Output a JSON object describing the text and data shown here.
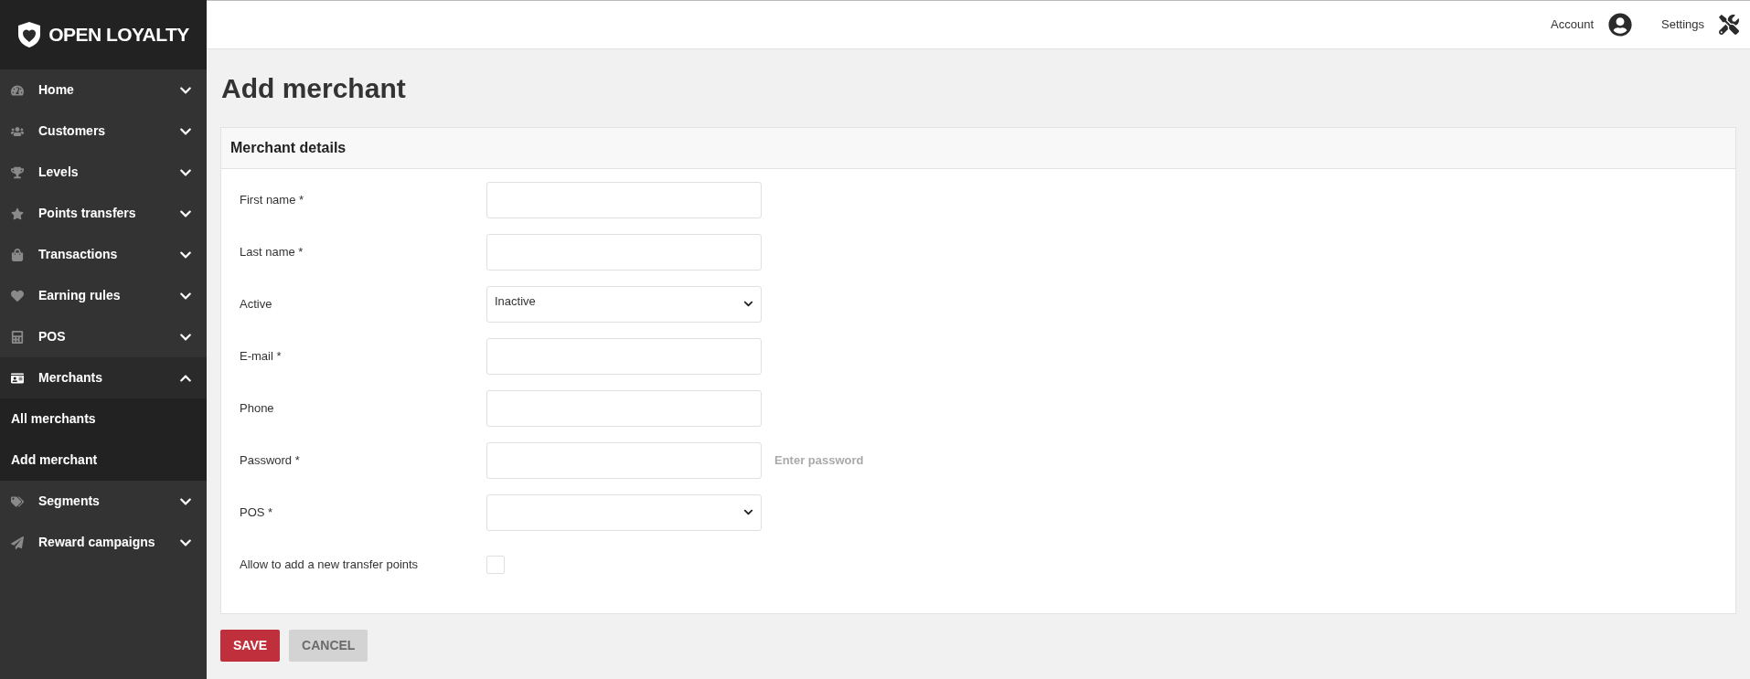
{
  "brand": {
    "name": "OPEN LOYALTY"
  },
  "sidebar": {
    "items": [
      {
        "label": "Home",
        "expanded": false
      },
      {
        "label": "Customers",
        "expanded": false
      },
      {
        "label": "Levels",
        "expanded": false
      },
      {
        "label": "Points transfers",
        "expanded": false
      },
      {
        "label": "Transactions",
        "expanded": false
      },
      {
        "label": "Earning rules",
        "expanded": false
      },
      {
        "label": "POS",
        "expanded": false
      },
      {
        "label": "Merchants",
        "expanded": true,
        "children": [
          {
            "label": "All merchants"
          },
          {
            "label": "Add merchant"
          }
        ]
      },
      {
        "label": "Segments",
        "expanded": false
      },
      {
        "label": "Reward campaigns",
        "expanded": false
      }
    ]
  },
  "topbar": {
    "account": "Account",
    "settings": "Settings"
  },
  "page_title": "Add merchant",
  "card": {
    "title": "Merchant details",
    "fields": [
      {
        "kind": "text",
        "label": "First name *"
      },
      {
        "kind": "text",
        "label": "Last name *"
      },
      {
        "kind": "select",
        "label": "Active",
        "value": "Inactive"
      },
      {
        "kind": "text",
        "label": "E-mail *"
      },
      {
        "kind": "text",
        "label": "Phone"
      },
      {
        "kind": "text",
        "label": "Password *",
        "hint": "Enter password"
      },
      {
        "kind": "select",
        "label": "POS *"
      },
      {
        "kind": "checkbox",
        "label": "Allow to add a new transfer points",
        "checked": false
      }
    ]
  },
  "buttons": [
    {
      "label": "SAVE",
      "disabled": false
    },
    {
      "label": "CANCEL",
      "disabled": true
    }
  ]
}
